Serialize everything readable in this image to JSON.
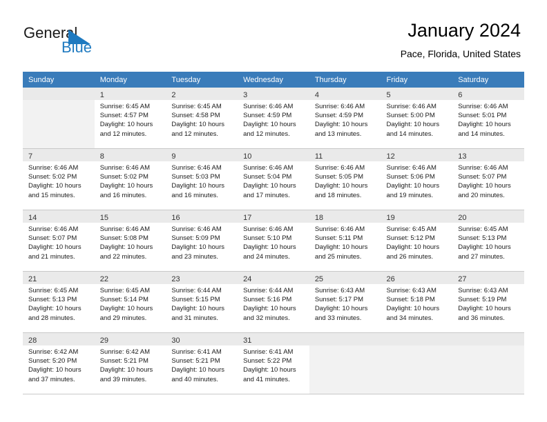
{
  "brand": {
    "name_part1": "General",
    "name_part2": "Blue",
    "flag_icon": "blue-triangle-flag-icon",
    "accent_color": "#1f7ac0"
  },
  "header": {
    "title": "January 2024",
    "subtitle": "Pace, Florida, United States"
  },
  "theme": {
    "header_row_bg": "#3a7cba",
    "header_row_text": "#ffffff",
    "shaded_row_bg": "#f2f2f2",
    "grid_line": "#c8c8c8"
  },
  "weekdays": [
    "Sunday",
    "Monday",
    "Tuesday",
    "Wednesday",
    "Thursday",
    "Friday",
    "Saturday"
  ],
  "labels": {
    "sunrise_prefix": "Sunrise: ",
    "sunset_prefix": "Sunset: ",
    "daylight_prefix": "Daylight: "
  },
  "weeks": [
    {
      "shaded": true,
      "days": [
        {
          "empty": true
        },
        {
          "day": "1",
          "sunrise": "Sunrise: 6:45 AM",
          "sunset": "Sunset: 4:57 PM",
          "daylight1": "Daylight: 10 hours",
          "daylight2": "and 12 minutes."
        },
        {
          "day": "2",
          "sunrise": "Sunrise: 6:45 AM",
          "sunset": "Sunset: 4:58 PM",
          "daylight1": "Daylight: 10 hours",
          "daylight2": "and 12 minutes."
        },
        {
          "day": "3",
          "sunrise": "Sunrise: 6:46 AM",
          "sunset": "Sunset: 4:59 PM",
          "daylight1": "Daylight: 10 hours",
          "daylight2": "and 12 minutes."
        },
        {
          "day": "4",
          "sunrise": "Sunrise: 6:46 AM",
          "sunset": "Sunset: 4:59 PM",
          "daylight1": "Daylight: 10 hours",
          "daylight2": "and 13 minutes."
        },
        {
          "day": "5",
          "sunrise": "Sunrise: 6:46 AM",
          "sunset": "Sunset: 5:00 PM",
          "daylight1": "Daylight: 10 hours",
          "daylight2": "and 14 minutes."
        },
        {
          "day": "6",
          "sunrise": "Sunrise: 6:46 AM",
          "sunset": "Sunset: 5:01 PM",
          "daylight1": "Daylight: 10 hours",
          "daylight2": "and 14 minutes."
        }
      ]
    },
    {
      "shaded": true,
      "days": [
        {
          "day": "7",
          "sunrise": "Sunrise: 6:46 AM",
          "sunset": "Sunset: 5:02 PM",
          "daylight1": "Daylight: 10 hours",
          "daylight2": "and 15 minutes."
        },
        {
          "day": "8",
          "sunrise": "Sunrise: 6:46 AM",
          "sunset": "Sunset: 5:02 PM",
          "daylight1": "Daylight: 10 hours",
          "daylight2": "and 16 minutes."
        },
        {
          "day": "9",
          "sunrise": "Sunrise: 6:46 AM",
          "sunset": "Sunset: 5:03 PM",
          "daylight1": "Daylight: 10 hours",
          "daylight2": "and 16 minutes."
        },
        {
          "day": "10",
          "sunrise": "Sunrise: 6:46 AM",
          "sunset": "Sunset: 5:04 PM",
          "daylight1": "Daylight: 10 hours",
          "daylight2": "and 17 minutes."
        },
        {
          "day": "11",
          "sunrise": "Sunrise: 6:46 AM",
          "sunset": "Sunset: 5:05 PM",
          "daylight1": "Daylight: 10 hours",
          "daylight2": "and 18 minutes."
        },
        {
          "day": "12",
          "sunrise": "Sunrise: 6:46 AM",
          "sunset": "Sunset: 5:06 PM",
          "daylight1": "Daylight: 10 hours",
          "daylight2": "and 19 minutes."
        },
        {
          "day": "13",
          "sunrise": "Sunrise: 6:46 AM",
          "sunset": "Sunset: 5:07 PM",
          "daylight1": "Daylight: 10 hours",
          "daylight2": "and 20 minutes."
        }
      ]
    },
    {
      "shaded": true,
      "days": [
        {
          "day": "14",
          "sunrise": "Sunrise: 6:46 AM",
          "sunset": "Sunset: 5:07 PM",
          "daylight1": "Daylight: 10 hours",
          "daylight2": "and 21 minutes."
        },
        {
          "day": "15",
          "sunrise": "Sunrise: 6:46 AM",
          "sunset": "Sunset: 5:08 PM",
          "daylight1": "Daylight: 10 hours",
          "daylight2": "and 22 minutes."
        },
        {
          "day": "16",
          "sunrise": "Sunrise: 6:46 AM",
          "sunset": "Sunset: 5:09 PM",
          "daylight1": "Daylight: 10 hours",
          "daylight2": "and 23 minutes."
        },
        {
          "day": "17",
          "sunrise": "Sunrise: 6:46 AM",
          "sunset": "Sunset: 5:10 PM",
          "daylight1": "Daylight: 10 hours",
          "daylight2": "and 24 minutes."
        },
        {
          "day": "18",
          "sunrise": "Sunrise: 6:46 AM",
          "sunset": "Sunset: 5:11 PM",
          "daylight1": "Daylight: 10 hours",
          "daylight2": "and 25 minutes."
        },
        {
          "day": "19",
          "sunrise": "Sunrise: 6:45 AM",
          "sunset": "Sunset: 5:12 PM",
          "daylight1": "Daylight: 10 hours",
          "daylight2": "and 26 minutes."
        },
        {
          "day": "20",
          "sunrise": "Sunrise: 6:45 AM",
          "sunset": "Sunset: 5:13 PM",
          "daylight1": "Daylight: 10 hours",
          "daylight2": "and 27 minutes."
        }
      ]
    },
    {
      "shaded": true,
      "days": [
        {
          "day": "21",
          "sunrise": "Sunrise: 6:45 AM",
          "sunset": "Sunset: 5:13 PM",
          "daylight1": "Daylight: 10 hours",
          "daylight2": "and 28 minutes."
        },
        {
          "day": "22",
          "sunrise": "Sunrise: 6:45 AM",
          "sunset": "Sunset: 5:14 PM",
          "daylight1": "Daylight: 10 hours",
          "daylight2": "and 29 minutes."
        },
        {
          "day": "23",
          "sunrise": "Sunrise: 6:44 AM",
          "sunset": "Sunset: 5:15 PM",
          "daylight1": "Daylight: 10 hours",
          "daylight2": "and 31 minutes."
        },
        {
          "day": "24",
          "sunrise": "Sunrise: 6:44 AM",
          "sunset": "Sunset: 5:16 PM",
          "daylight1": "Daylight: 10 hours",
          "daylight2": "and 32 minutes."
        },
        {
          "day": "25",
          "sunrise": "Sunrise: 6:43 AM",
          "sunset": "Sunset: 5:17 PM",
          "daylight1": "Daylight: 10 hours",
          "daylight2": "and 33 minutes."
        },
        {
          "day": "26",
          "sunrise": "Sunrise: 6:43 AM",
          "sunset": "Sunset: 5:18 PM",
          "daylight1": "Daylight: 10 hours",
          "daylight2": "and 34 minutes."
        },
        {
          "day": "27",
          "sunrise": "Sunrise: 6:43 AM",
          "sunset": "Sunset: 5:19 PM",
          "daylight1": "Daylight: 10 hours",
          "daylight2": "and 36 minutes."
        }
      ]
    },
    {
      "shaded": true,
      "days": [
        {
          "day": "28",
          "sunrise": "Sunrise: 6:42 AM",
          "sunset": "Sunset: 5:20 PM",
          "daylight1": "Daylight: 10 hours",
          "daylight2": "and 37 minutes."
        },
        {
          "day": "29",
          "sunrise": "Sunrise: 6:42 AM",
          "sunset": "Sunset: 5:21 PM",
          "daylight1": "Daylight: 10 hours",
          "daylight2": "and 39 minutes."
        },
        {
          "day": "30",
          "sunrise": "Sunrise: 6:41 AM",
          "sunset": "Sunset: 5:21 PM",
          "daylight1": "Daylight: 10 hours",
          "daylight2": "and 40 minutes."
        },
        {
          "day": "31",
          "sunrise": "Sunrise: 6:41 AM",
          "sunset": "Sunset: 5:22 PM",
          "daylight1": "Daylight: 10 hours",
          "daylight2": "and 41 minutes."
        },
        {
          "empty": true
        },
        {
          "empty": true
        },
        {
          "empty": true
        }
      ]
    }
  ]
}
